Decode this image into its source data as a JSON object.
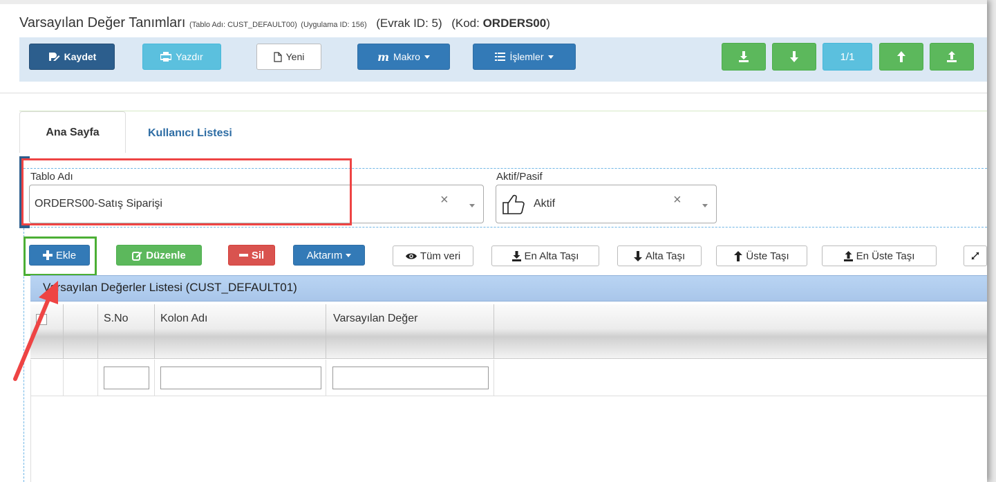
{
  "header": {
    "title": "Varsayılan Değer Tanımları",
    "table_info": "(Tablo Adı: CUST_DEFAULT00)",
    "app_info": "(Uygulama ID: 156)",
    "evrak": "(Evrak ID: 5)",
    "kod_label": "(Kod:",
    "kod_value": "ORDERS00",
    "kod_close": ")"
  },
  "toolbar": {
    "save_label": "Kaydet",
    "print_label": "Yazdır",
    "new_label": "Yeni",
    "macro_label": "Makro",
    "ops_label": "İşlemler",
    "pager": "1/1"
  },
  "tabs": [
    {
      "label": "Ana Sayfa"
    },
    {
      "label": "Kullanıcı Listesi"
    }
  ],
  "form": {
    "table_label": "Tablo Adı",
    "table_value": "ORDERS00-Satış Siparişi",
    "active_label": "Aktif/Pasif",
    "active_value": "Aktif",
    "clear_symbol": "×"
  },
  "grid_toolbar": {
    "add_label": "Ekle",
    "edit_label": "Düzenle",
    "delete_label": "Sil",
    "transfer_label": "Aktarım",
    "all_data_label": "Tüm veri",
    "move_bottom_label": "En Alta Taşı",
    "move_down_label": "Alta Taşı",
    "move_up_label": "Üste Taşı",
    "move_top_label": "En Üste Taşı"
  },
  "grid": {
    "title": "Varsayılan Değerler Listesi (CUST_DEFAULT01)",
    "columns": [
      "S.No",
      "Kolon Adı",
      "Varsayılan Değer"
    ]
  },
  "colors": {
    "annotation_red": "#e44444",
    "annotation_green": "#4caf35",
    "primary": "#337ab7",
    "success": "#5cb85c",
    "danger": "#d9534f",
    "info": "#5bc0de"
  }
}
